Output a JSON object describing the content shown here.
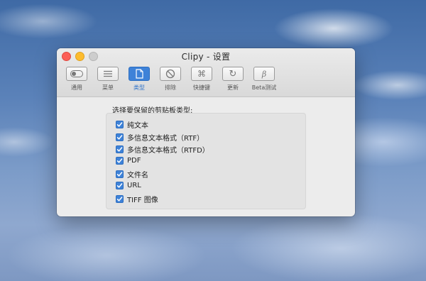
{
  "window": {
    "title": "Clipy - 设置"
  },
  "toolbar": {
    "items": [
      {
        "label": "通用",
        "icon": "toggle-switch-icon",
        "active": false
      },
      {
        "label": "菜单",
        "icon": "menu-lines-icon",
        "active": false
      },
      {
        "label": "类型",
        "icon": "document-icon",
        "active": true
      },
      {
        "label": "排除",
        "icon": "no-entry-icon",
        "active": false
      },
      {
        "label": "快捷键",
        "icon": "command-key-icon",
        "active": false
      },
      {
        "label": "更新",
        "icon": "refresh-icon",
        "active": false
      },
      {
        "label": "Beta测试",
        "icon": "beta-icon",
        "active": false
      }
    ]
  },
  "types": {
    "heading": "选择要保留的剪贴板类型:",
    "items": [
      {
        "label": "纯文本",
        "checked": true
      },
      {
        "label": "多信息文本格式（RTF）",
        "checked": true
      },
      {
        "label": "多信息文本格式（RTFD）",
        "checked": true
      },
      {
        "label": "PDF",
        "checked": true
      },
      {
        "label": "文件名",
        "checked": true
      },
      {
        "label": "URL",
        "checked": true
      },
      {
        "label": "TIFF 图像",
        "checked": true
      }
    ]
  },
  "colors": {
    "accent": "#3e82d8",
    "active_label": "#2f73c9"
  }
}
